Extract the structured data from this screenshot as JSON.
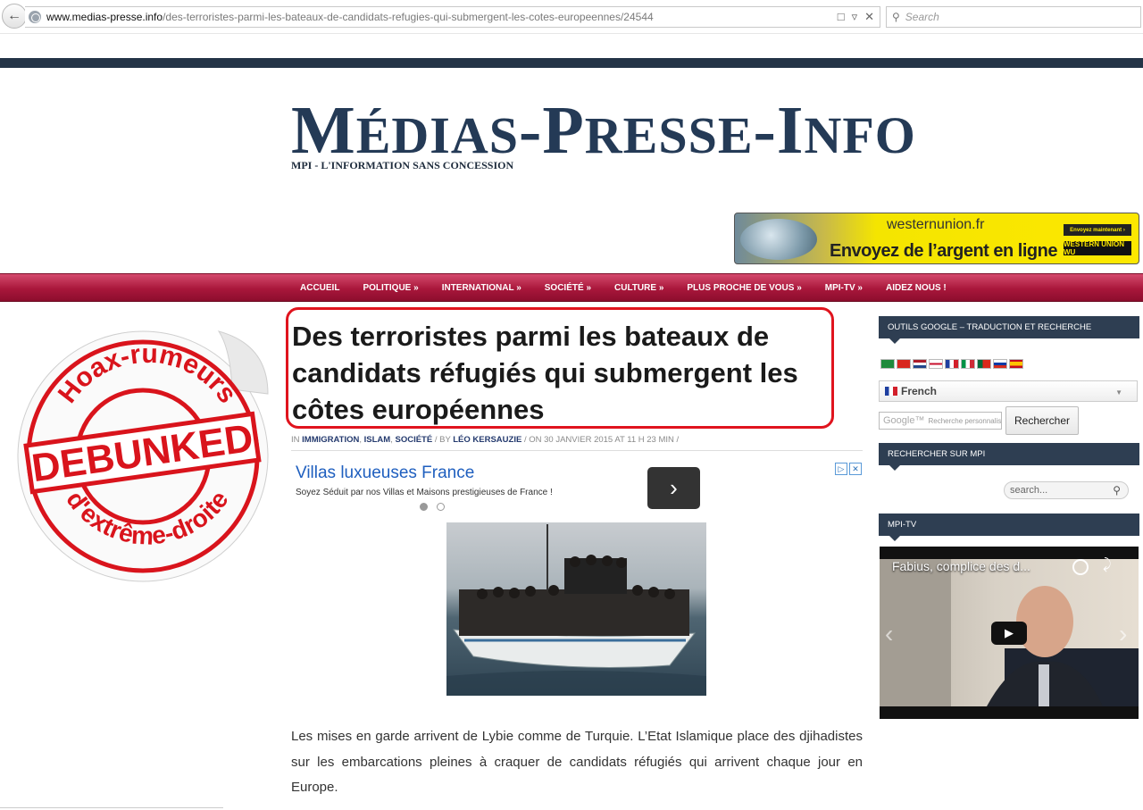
{
  "browser": {
    "url_domain": "www.medias-presse.info",
    "url_path": "/des-terroristes-parmi-les-bateaux-de-candidats-refugies-qui-submergent-les-cotes-europeennes/24544",
    "search_placeholder": "Search"
  },
  "site": {
    "logo_parts": [
      "M",
      "ÉDIAS",
      "-P",
      "RESSE",
      "-I",
      "NFO"
    ],
    "tagline": "MPI - L'INFORMATION SANS CONCESSION"
  },
  "banner_ad": {
    "domain": "westernunion.fr",
    "slogan": "Envoyez de l’argent en ligne",
    "cta": "Envoyez maintenant ›",
    "brand": "WESTERN UNION WU"
  },
  "nav": {
    "items": [
      "ACCUEIL",
      "POLITIQUE »",
      "INTERNATIONAL »",
      "SOCIÉTÉ »",
      "CULTURE »",
      "PLUS PROCHE DE VOUS »",
      "MPI-TV »",
      "AIDEZ NOUS !"
    ]
  },
  "badge": {
    "top_text": "Hoax-rumeurs",
    "center_text": "DEBUNKED",
    "bottom_text": "d'extrême-droite"
  },
  "article": {
    "title": "Des terroristes parmi les bateaux de candidats réfugiés qui submergent les côtes européennes",
    "meta_in": "IN",
    "categories": [
      "IMMIGRATION",
      "ISLAM",
      "SOCIÉTÉ"
    ],
    "meta_by": "/ BY",
    "author": "LÉO KERSAUZIE",
    "meta_date": "/ ON 30 JANVIER 2015 AT 11 H 23 MIN /",
    "body": "Les mises en garde arrivent de Lybie comme de Turquie. L’Etat Islamique place des djihadistes sur les embarcations pleines à craquer de candidats réfugiés qui arrivent chaque jour en Europe."
  },
  "inline_ad": {
    "title": "Villas luxueuses France",
    "subtitle": "Soyez Séduit par nos Villas et Maisons prestigieuses de France !",
    "next_symbol": "›",
    "choice_icons": [
      "▷",
      "✕"
    ]
  },
  "sidebar": {
    "google_tools_title": "OUTILS GOOGLE – TRADUCTION ET RECHERCHE",
    "language": "French",
    "google_search_brand": "Google™",
    "google_search_placeholder": "Recherche personnalisée",
    "google_search_button": "Rechercher",
    "mpi_search_title": "RECHERCHER SUR MPI",
    "mpi_search_placeholder": "search...",
    "mpitv_title": "MPI-TV",
    "video_title": "Fabius, complice des d..."
  },
  "colors": {
    "nav_red": "#a9173b",
    "logo_navy": "#243a56",
    "highlight_red": "#e0141e",
    "ad_yellow": "#fde800"
  }
}
